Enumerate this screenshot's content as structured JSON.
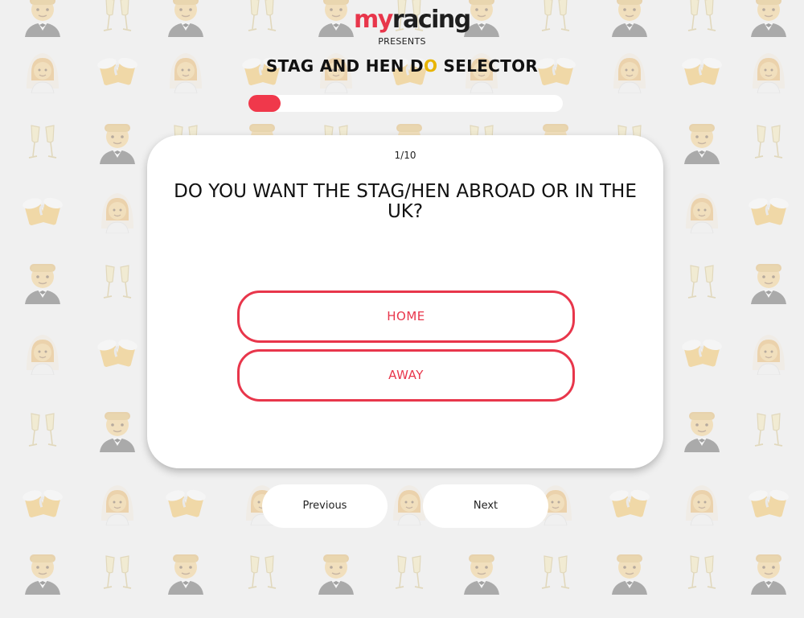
{
  "brand": {
    "logo_my": "my",
    "logo_racing": "racing",
    "presents": "PRESENTS",
    "title_part1": "STAG AND HEN D",
    "title_highlight": "O",
    "title_part2": " SELECTOR"
  },
  "progress": {
    "current": 1,
    "total": 10,
    "fraction": 0.1,
    "fill_color": "#f0384b"
  },
  "question": {
    "counter": "1/10",
    "text": "DO YOU WANT THE STAG/HEN ABROAD OR IN THE UK?",
    "answers": [
      "HOME",
      "AWAY"
    ]
  },
  "navigation": {
    "previous_label": "Previous",
    "next_label": "Next"
  },
  "colors": {
    "accent": "#e8364b",
    "highlight": "#e8b400",
    "background": "#f0f0f0"
  },
  "background_icons": [
    "groom-emoji-icon",
    "bride-emoji-icon",
    "champagne-glasses-icon",
    "beer-mugs-icon"
  ]
}
